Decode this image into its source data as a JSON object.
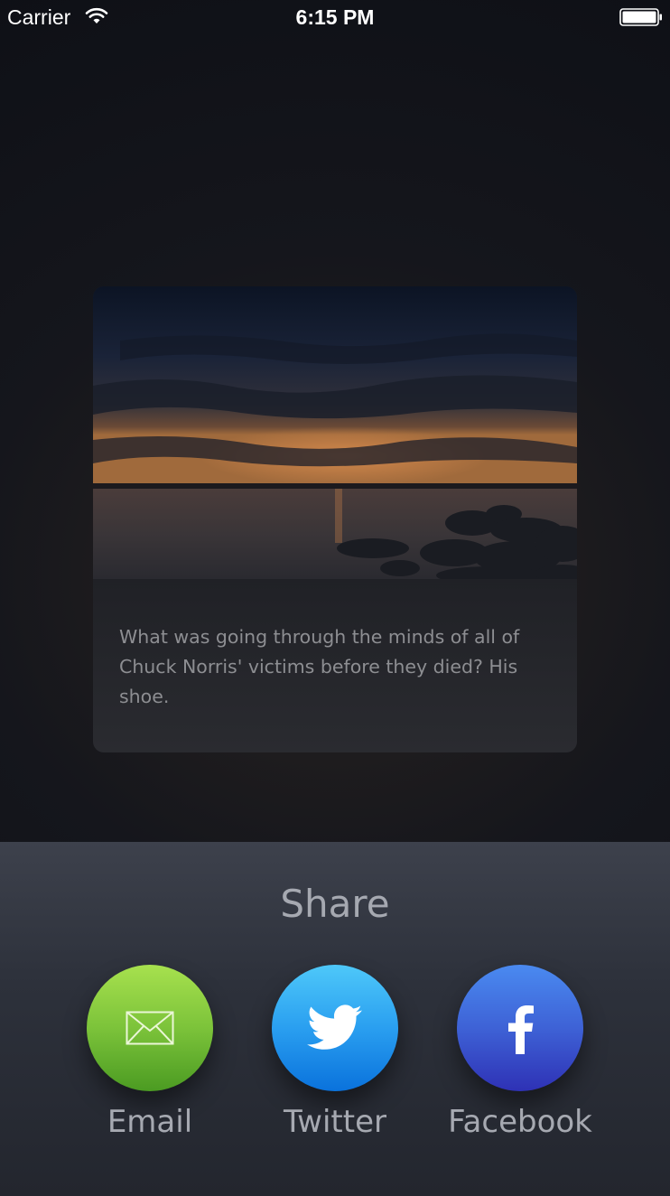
{
  "status_bar": {
    "carrier": "Carrier",
    "time": "6:15 PM",
    "wifi_icon": "wifi-icon",
    "battery_icon": "battery-icon"
  },
  "card": {
    "image": "sunset-lake-photo",
    "text": "What was going through the minds of all of Chuck Norris' victims before they died? His shoe."
  },
  "share": {
    "title": "Share",
    "options": [
      {
        "label": "Email",
        "icon": "envelope-icon",
        "color": "#7cc33a"
      },
      {
        "label": "Twitter",
        "icon": "twitter-bird-icon",
        "color": "#2a9ff0"
      },
      {
        "label": "Facebook",
        "icon": "facebook-f-icon",
        "color": "#3e62d6"
      }
    ]
  }
}
